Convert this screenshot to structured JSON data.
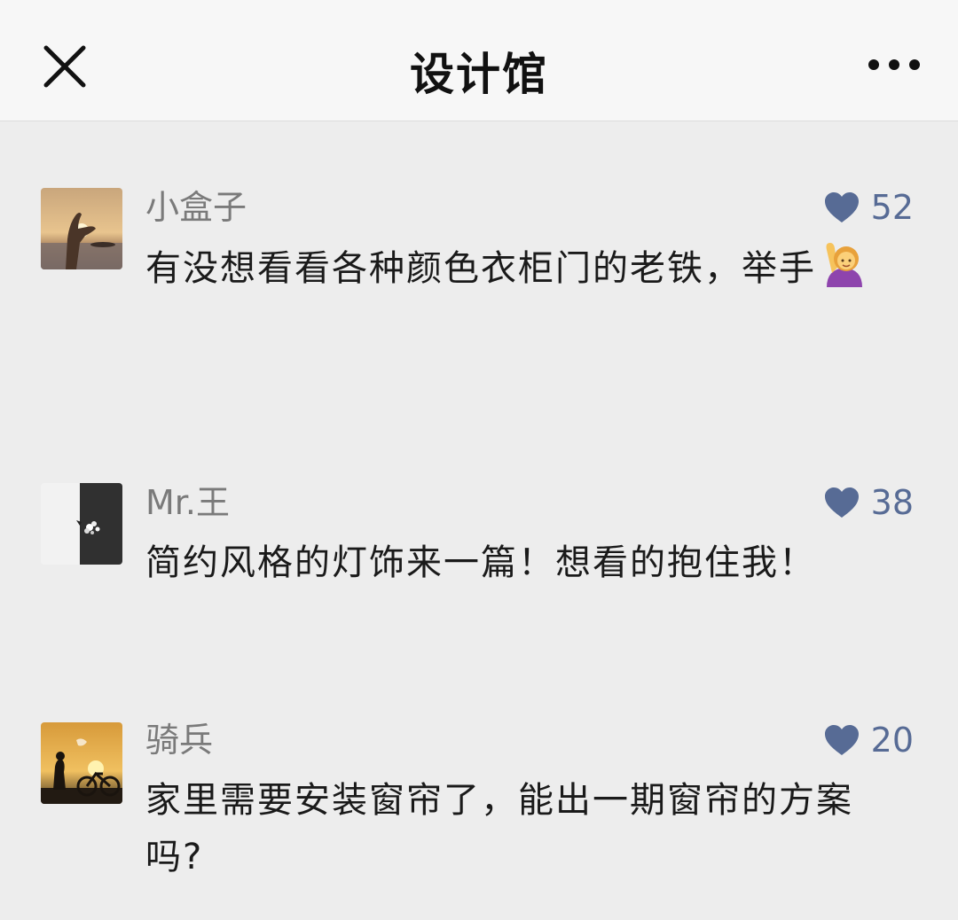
{
  "header": {
    "title": "设计馆",
    "close_icon": "close-icon",
    "more_icon": "more-dots-icon"
  },
  "colors": {
    "background": "#ededed",
    "header_bg": "#f7f7f7",
    "username": "#7a7a7a",
    "like_accent": "#576b95",
    "text": "#1a1a1a"
  },
  "comments": [
    {
      "username": "小盒子",
      "likes": "52",
      "text": "有没想看看各种颜色衣柜门的老铁，举手",
      "emoji": "raising-hand-emoji",
      "avatar": "sunset-hand-photo"
    },
    {
      "username": "Mr.王",
      "likes": "38",
      "text": "简约风格的灯饰来一篇！想看的抱住我！",
      "avatar": "black-white-flower-photo"
    },
    {
      "username": "骑兵",
      "likes": "20",
      "text": "家里需要安装窗帘了，能出一期窗帘的方案吗?",
      "avatar": "cyclist-sunset-photo"
    }
  ]
}
